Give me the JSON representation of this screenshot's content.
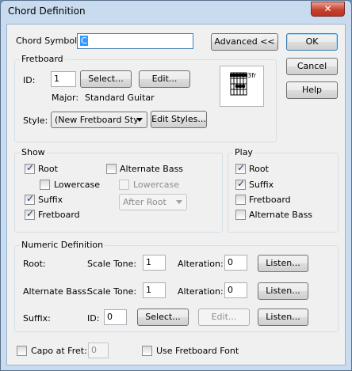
{
  "window": {
    "title": "Chord Definition",
    "close_glyph": "✕"
  },
  "chord_symbol": {
    "label": "Chord Symbol:",
    "value": "C"
  },
  "buttons": {
    "advanced": "Advanced <<",
    "ok": "OK",
    "cancel": "Cancel",
    "help": "Help"
  },
  "fretboard": {
    "group_label": "Fretboard",
    "id_label": "ID:",
    "id_value": "1",
    "select": "Select...",
    "edit": "Edit...",
    "major_label": "Major:",
    "major_value": "Standard Guitar",
    "style_label": "Style:",
    "style_value": "(New Fretboard Sty",
    "edit_styles": "Edit Styles...",
    "diagram_fret_label": "3fr"
  },
  "show": {
    "group_label": "Show",
    "root": {
      "label": "Root",
      "checked": true
    },
    "lowercase": {
      "label": "Lowercase",
      "checked": false
    },
    "suffix": {
      "label": "Suffix",
      "checked": true
    },
    "fretboard": {
      "label": "Fretboard",
      "checked": true
    },
    "alternate_bass": {
      "label": "Alternate Bass",
      "checked": false
    },
    "alt_lowercase": {
      "label": "Lowercase",
      "checked": false
    },
    "alt_position": "After Root"
  },
  "play": {
    "group_label": "Play",
    "root": {
      "label": "Root",
      "checked": true
    },
    "suffix": {
      "label": "Suffix",
      "checked": true
    },
    "fretboard": {
      "label": "Fretboard",
      "checked": false
    },
    "alternate_bass": {
      "label": "Alternate Bass",
      "checked": false
    }
  },
  "numeric": {
    "group_label": "Numeric Definition",
    "root_label": "Root:",
    "alt_bass_label": "Alternate Bass:",
    "suffix_label": "Suffix:",
    "scale_tone_label": "Scale Tone:",
    "alteration_label": "Alteration:",
    "id_label": "ID:",
    "root_scale_tone": "1",
    "root_alteration": "0",
    "alt_scale_tone": "1",
    "alt_alteration": "0",
    "suffix_id": "0",
    "select": "Select...",
    "edit": "Edit...",
    "listen": "Listen..."
  },
  "capo": {
    "label": "Capo at Fret:",
    "checked": false,
    "value": "0"
  },
  "use_fretboard_font": {
    "label": "Use Fretboard Font",
    "checked": false
  },
  "check_glyph": "✓"
}
